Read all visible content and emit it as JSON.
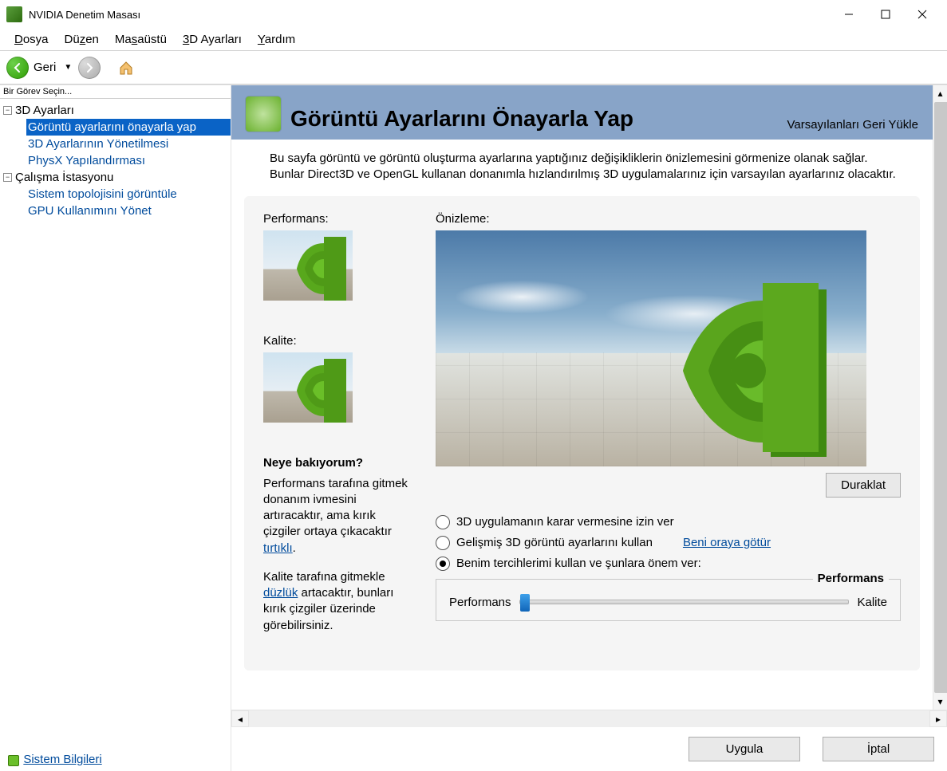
{
  "window": {
    "title": "NVIDIA Denetim Masası"
  },
  "menu": {
    "file": "Dosya",
    "edit": "Düzen",
    "desktop": "Masaüstü",
    "settings3d": "3D Ayarları",
    "help": "Yardım",
    "file_u": "D",
    "edit_u": "z",
    "desktop_u": "s",
    "settings3d_u": "3",
    "help_u": "Y"
  },
  "nav": {
    "back": "Geri"
  },
  "sidebar": {
    "title": "Bir Görev Seçin...",
    "groups": [
      {
        "label": "3D Ayarları",
        "items": [
          {
            "label": "Görüntü ayarlarını önayarla yap",
            "selected": true
          },
          {
            "label": "3D Ayarlarının Yönetilmesi",
            "selected": false
          },
          {
            "label": "PhysX Yapılandırması",
            "selected": false
          }
        ]
      },
      {
        "label": "Çalışma İstasyonu",
        "items": [
          {
            "label": "Sistem topolojisini görüntüle",
            "selected": false
          },
          {
            "label": "GPU Kullanımını Yönet",
            "selected": false
          }
        ]
      }
    ],
    "system_info": "Sistem Bilgileri"
  },
  "page": {
    "title": "Görüntü Ayarlarını Önayarla Yap",
    "restore": "Varsayılanları Geri Yükle",
    "desc": "Bu sayfa görüntü ve görüntü oluşturma ayarlarına yaptığınız değişikliklerin önizlemesini görmenize olanak sağlar. Bunlar Direct3D ve OpenGL kullanan donanımla hızlandırılmış 3D uygulamalarınız için varsayılan ayarlarınız olacaktır.",
    "performance_label": "Performans:",
    "quality_label": "Kalite:",
    "help_title": "Neye bakıyorum?",
    "help_p1_a": "Performans tarafına gitmek donanım ivmesini artıracaktır, ama kırık çizgiler ortaya çıkacaktır ",
    "help_p1_link": "tırtıklı",
    "help_p1_b": ".",
    "help_p2_a": "Kalite tarafına  gitmekle ",
    "help_p2_link": "düzlük",
    "help_p2_b": " artacaktır, bunları kırık çizgiler üzerinde görebilirsiniz.",
    "preview_label": "Önizleme:",
    "pause": "Duraklat",
    "radios": {
      "r1": "3D uygulamanın karar vermesine izin ver",
      "r2": "Gelişmiş 3D görüntü ayarlarını kullan",
      "r2_link": "Beni oraya götür",
      "r3": "Benim tercihlerimi kullan ve şunlara önem ver:"
    },
    "slider": {
      "title": "Performans",
      "left": "Performans",
      "right": "Kalite"
    }
  },
  "footer": {
    "apply": "Uygula",
    "cancel": "İptal"
  }
}
